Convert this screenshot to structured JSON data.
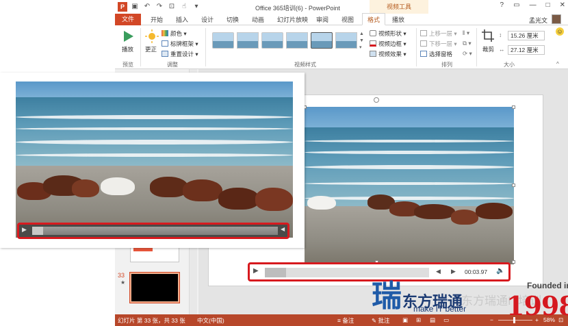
{
  "window": {
    "title": "Office 365培训(6) - PowerPoint",
    "context_tab_title": "视频工具",
    "controls": [
      "?",
      "□",
      "—",
      "□",
      "✕"
    ],
    "qat_icons": [
      "powerpoint-logo",
      "save-icon",
      "undo-icon",
      "redo-icon",
      "slideshow-icon",
      "touch-mode-icon",
      "customize-icon"
    ]
  },
  "tabs": {
    "file": "文件",
    "items": [
      "开始",
      "插入",
      "设计",
      "切换",
      "动画",
      "幻灯片放映",
      "审阅",
      "视图",
      "格式",
      "播放"
    ],
    "active": "格式",
    "user": "孟光文"
  },
  "ribbon": {
    "preview": {
      "play_label": "播放",
      "group_label": "预览"
    },
    "adjust": {
      "correct_label": "更正",
      "color_label": "颜色",
      "poster_frame_label": "标牌框架",
      "reset_design_label": "重置设计",
      "group_label": "调整"
    },
    "video_styles": {
      "group_label": "视频样式",
      "thumb_count": 7
    },
    "video_format": {
      "shape_label": "视频形状",
      "border_label": "视频边框",
      "effects_label": "视频效果"
    },
    "arrange": {
      "bring_forward": "上移一层",
      "send_backward": "下移一层",
      "selection_pane": "选择窗格",
      "group_label": "排列"
    },
    "size": {
      "crop_label": "裁剪",
      "height": "15.26 厘米",
      "width": "27.12 厘米",
      "group_label": "大小"
    }
  },
  "thumbnails": {
    "current_number": "33",
    "current_marker": "★"
  },
  "media_bar": {
    "play_icon": "▶",
    "time": "00:03.97",
    "progress": 0.13
  },
  "zoom_bar": {
    "play_icon": "▶",
    "progress": 0.045
  },
  "status": {
    "slide_info": "幻灯片 第 33 张，共 33 张",
    "language": "中文(中国)",
    "notes": "备注",
    "comments": "批注",
    "zoom": "58%"
  },
  "watermark": {
    "founded": "Founded in",
    "year": "1998",
    "brand": "东方瑞通",
    "slogan": "make IT better",
    "tagline": "东方瑞通IT培训"
  },
  "colors": {
    "accent": "#d24726",
    "status_bar": "#b7472a",
    "highlight_border": "#d7191e"
  }
}
